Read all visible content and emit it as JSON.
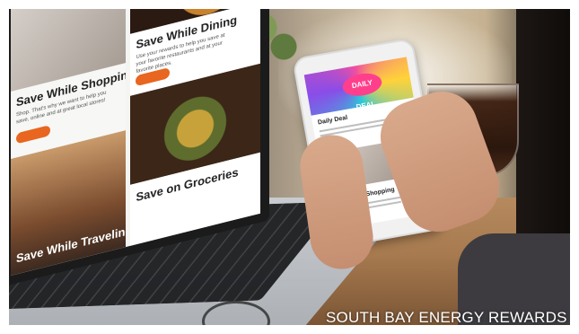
{
  "laptop_screen": {
    "tiles": {
      "shopping_title": "Save While Shopping",
      "shopping_text": "Shop. That's why we want to help you save, online and at great local stores!",
      "dining_title": "Save While Dining",
      "dining_text": "Use your rewards to help you save at your favorite restaurants and at your favorite places.",
      "groceries_title": "Save on Groceries",
      "traveling_title": "Save While Traveling"
    }
  },
  "phone_screen": {
    "banner_title": "DAILY DEAL",
    "deal_title": "Daily Deal",
    "shopping_title": "Save While Shopping"
  },
  "watermark": "SOUTH BAY ENERGY REWARDS",
  "colors": {
    "accent": "#e8661f"
  }
}
